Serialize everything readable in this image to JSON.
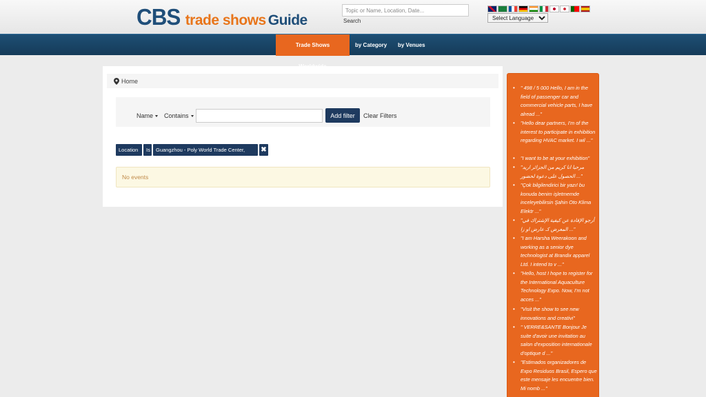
{
  "header": {
    "logo": {
      "cbs": "CBS",
      "trade_shows": "trade shows",
      "guide": "Guide"
    },
    "search_placeholder": "Topic or Name, Location, Date...",
    "search_label": "Search",
    "language_select": "Select Language"
  },
  "nav": {
    "items": [
      {
        "label": "Trade Shows Worldwide",
        "active": true
      },
      {
        "label": "by Category",
        "active": false
      },
      {
        "label": "by Venues",
        "active": false
      }
    ]
  },
  "breadcrumb": {
    "home": "Home"
  },
  "filter": {
    "field_label": "Name",
    "operator_label": "Contains",
    "add_label": "Add filter",
    "clear_label": "Clear Filters"
  },
  "active_filter": {
    "field": "Location",
    "operator": "Is",
    "value": "Guangzhou - Poly World Trade Center, China",
    "remove": "✖"
  },
  "results": {
    "empty_text": "No events"
  },
  "sidebar": {
    "quotes": [
      "\" 498 / 5 000 Hello, I am in the field of passenger car and commercial vehicle parts, I have alread ...\"",
      "\"Hello dear partners, I'm of the interest to participate in exhibition regarding HVAC market. I wil ...\"",
      "\"I want to be at your exhibition\"",
      "\"مرحبا انا كريم من الجزائر اريد الحصول على دعوة لحضور ...\"",
      "\"Çok bilgilendirici bir yazı! bu konuda benim işletmemde inceleyebilirsin Şahin Oto Klima Elektr ...\"",
      "\"أرجو الإفادة عن كيفية الإشتراك في المعرض كـ عارض او زا ...\"",
      "\"I am Harsha Weerakoon and working as a senior dye technologist at Brandix apparel Ltd. I intend to v ...\"",
      "\"Hello, host I hope to register for the International Aquaculture Technology Expo. Now, I'm not acces ...\"",
      "\"Visit the show to see new innovations and creativi\"",
      "\" VERRE&SANTE Bonjour Je suite d'avoir une invitation au salon d'exposition internationale d'optique d ...\"",
      "\"Estimados organizadores de Expo Residuos Brasil, Espero que este mensaje les encuentre bien. Mi nomb ...\""
    ]
  },
  "colors": {
    "brand_blue": "#1f4e79",
    "brand_orange": "#e8751a",
    "nav_bg": "#1a4667",
    "active_nav": "#e8671f",
    "chip_bg": "#1e3a5f"
  }
}
